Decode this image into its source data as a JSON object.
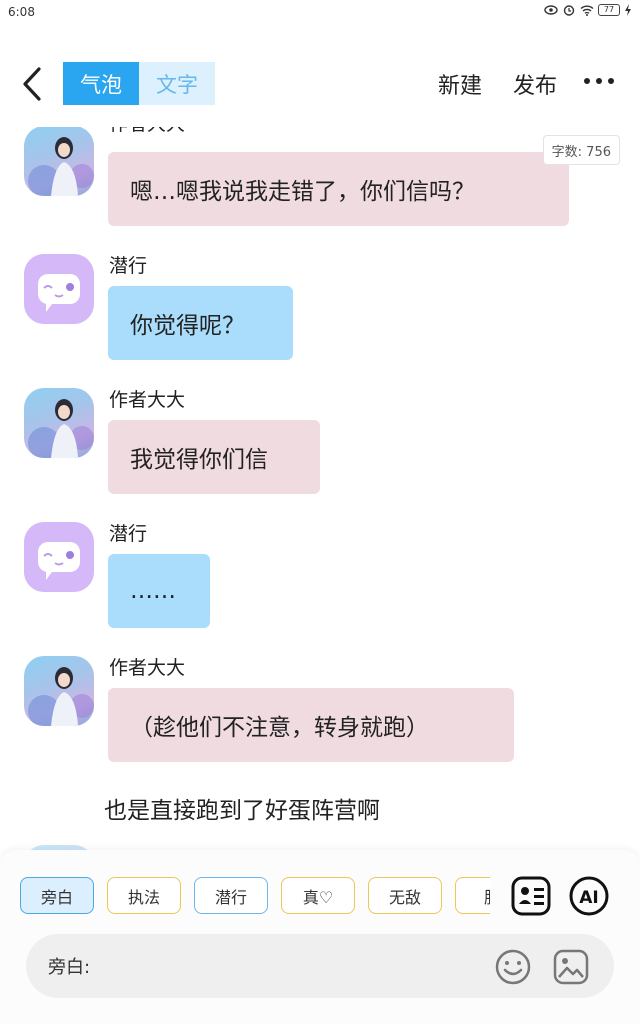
{
  "status": {
    "time": "6:08",
    "battery": "77"
  },
  "header": {
    "tabs": [
      {
        "label": "气泡",
        "active": true
      },
      {
        "label": "文字",
        "active": false
      }
    ],
    "new_label": "新建",
    "publish_label": "发布"
  },
  "chat": {
    "word_count": "字数: 756",
    "messages": [
      {
        "speaker": "作者大大",
        "avatar": "photo",
        "text": "嗯…嗯我说我走错了，你们信吗？",
        "color": "pink"
      },
      {
        "speaker": "潜行",
        "avatar": "mask-icon",
        "text": "你觉得呢？",
        "color": "blue"
      },
      {
        "speaker": "作者大大",
        "avatar": "photo",
        "text": "我觉得你们信",
        "color": "pink"
      },
      {
        "speaker": "潜行",
        "avatar": "mask-icon",
        "text": "……",
        "color": "blue"
      },
      {
        "speaker": "作者大大",
        "avatar": "photo",
        "text": "（趁他们不注意，转身就跑）",
        "color": "pink"
      }
    ],
    "narration": "也是直接跑到了好蛋阵营啊"
  },
  "bottom": {
    "chips": [
      "旁白",
      "执法",
      "潜行",
      "真♡",
      "无敌",
      "肥"
    ],
    "input_prefix": "旁白:",
    "input_value": "",
    "icons": [
      "contacts-icon",
      "ai-icon",
      "emoji-icon",
      "image-icon"
    ]
  },
  "colors": {
    "accent": "#2aa6f0",
    "pink_bubble": "#f0dbe0",
    "blue_bubble": "#a9ddfb",
    "chip_border": "#e8c85a"
  }
}
